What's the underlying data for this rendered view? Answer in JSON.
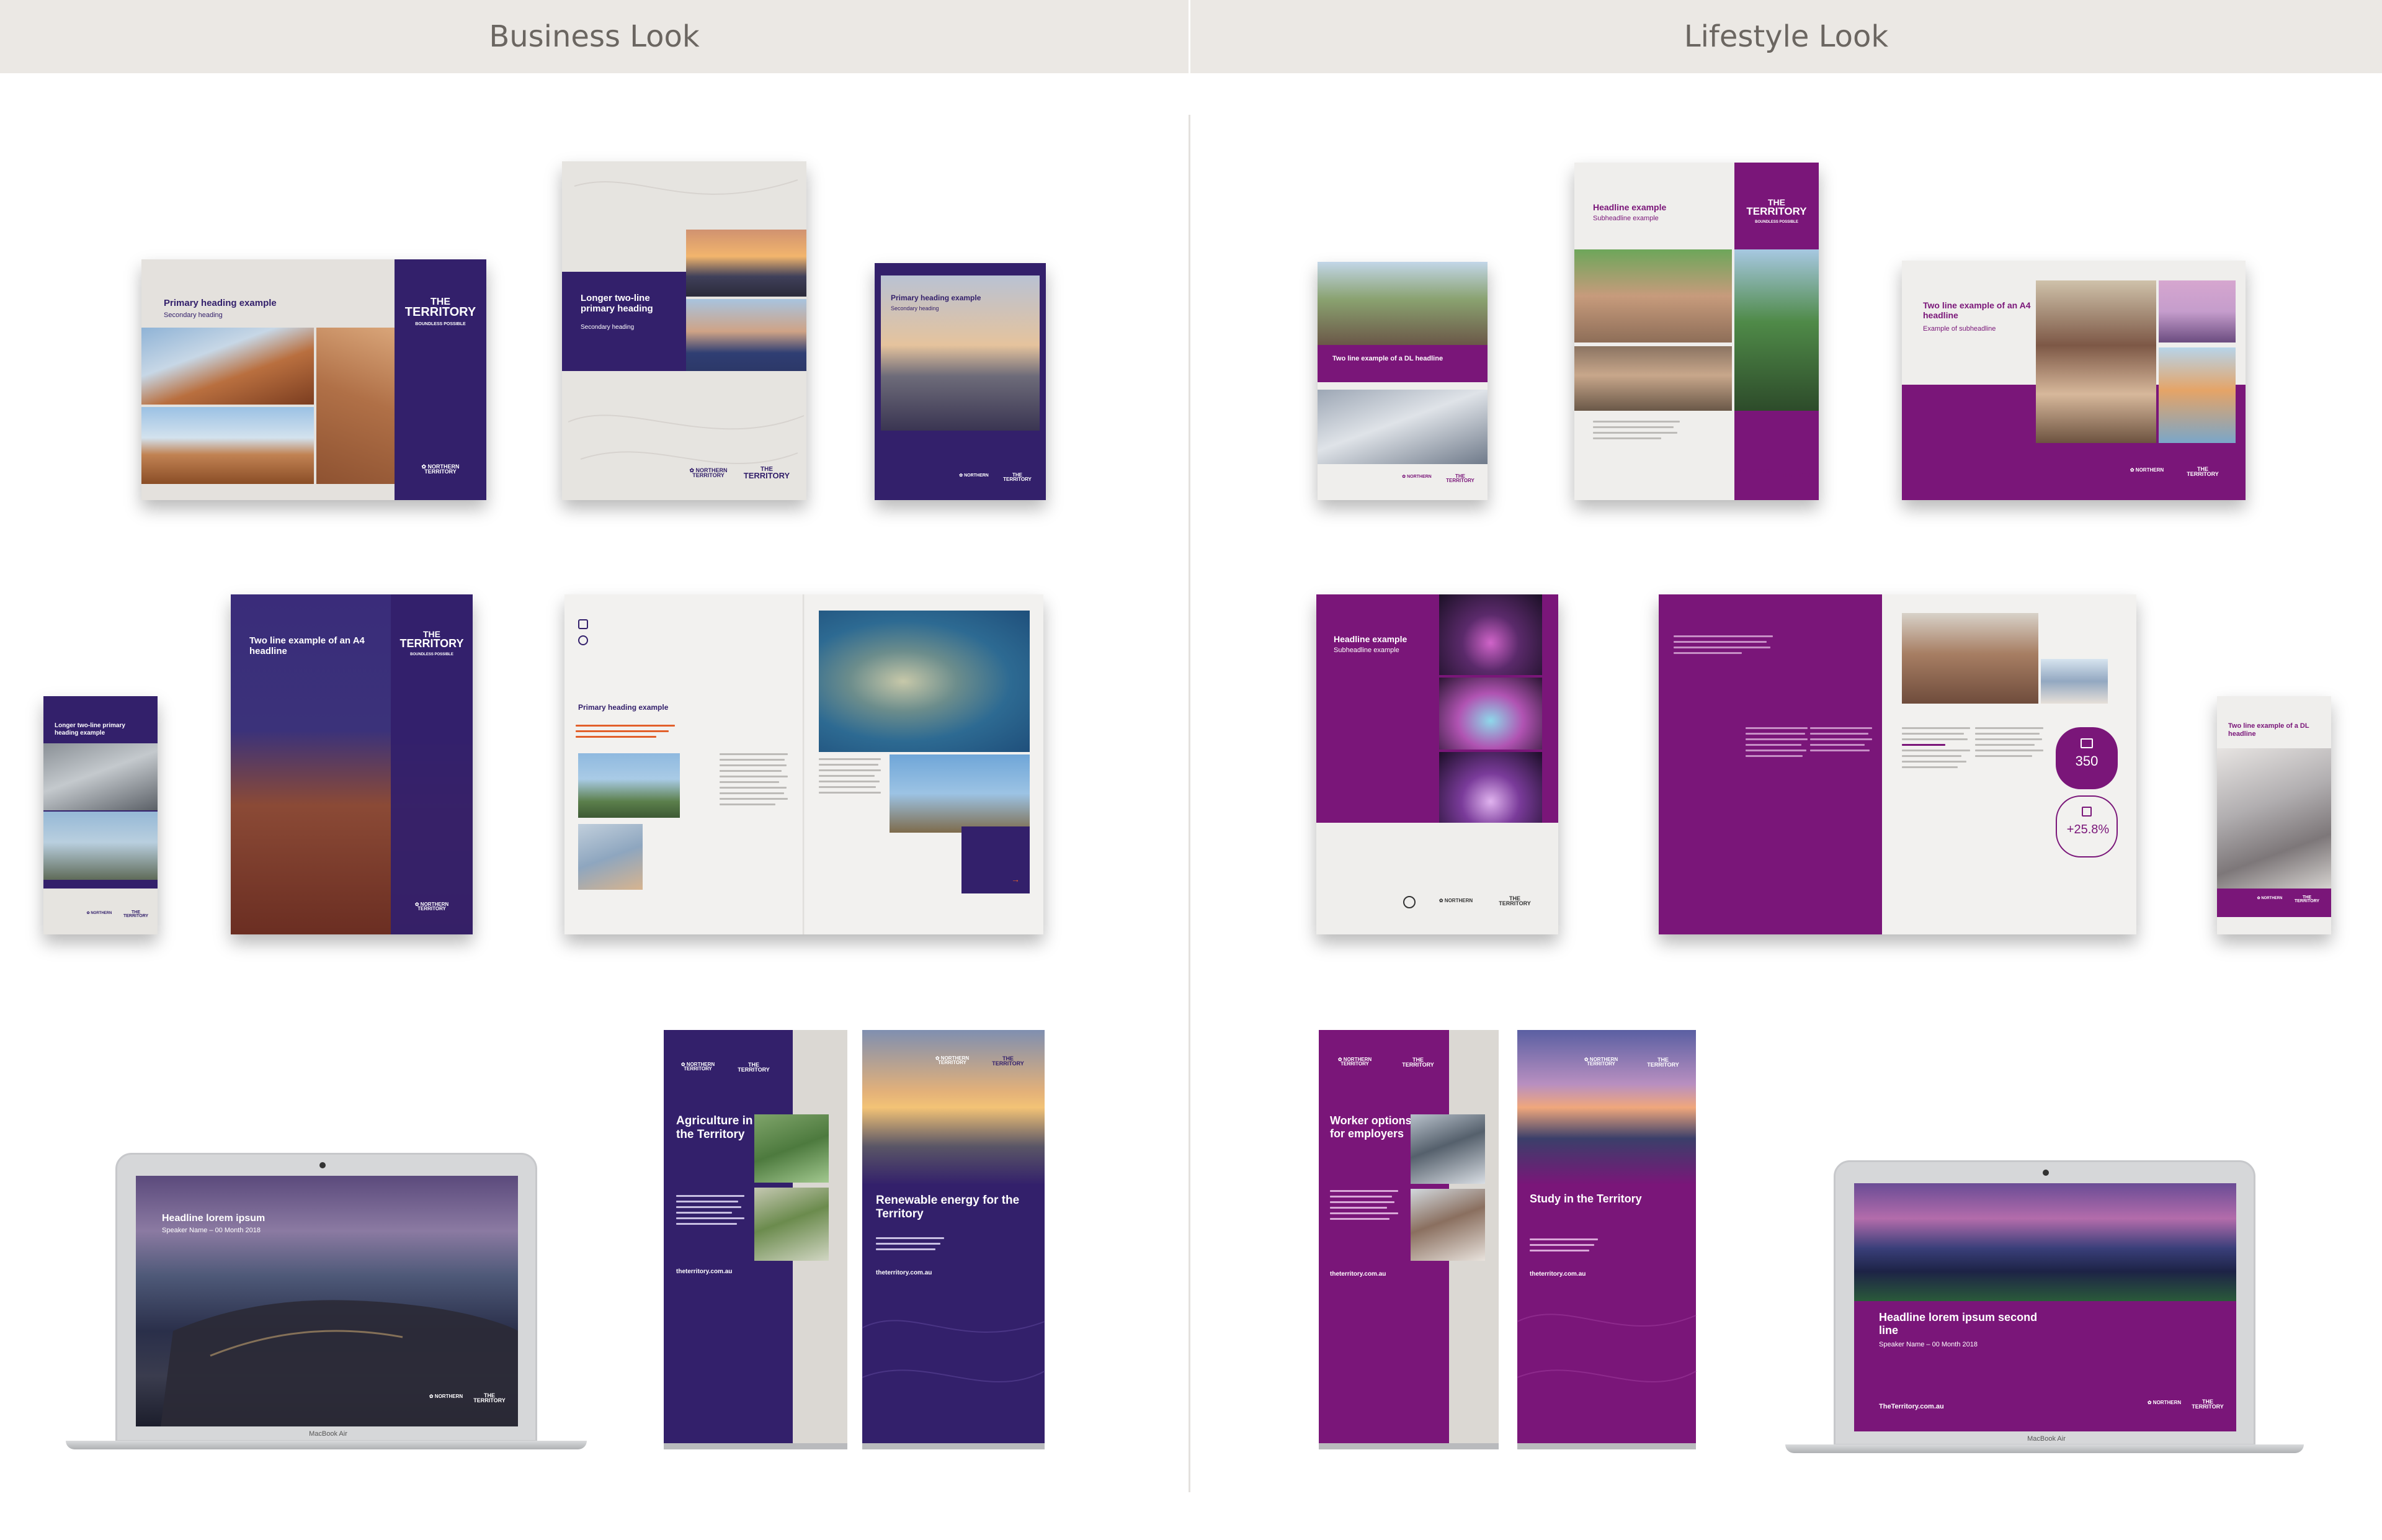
{
  "headers": {
    "business": "Business Look",
    "lifestyle": "Lifestyle Look"
  },
  "colors": {
    "business_purple": "#33206b",
    "lifestyle_purple": "#7a1679",
    "header_bg": "#ebe8e4",
    "header_text": "#6b6661",
    "accent_orange": "#e2602b"
  },
  "brand": {
    "logo_line1": "THE",
    "logo_line2": "TERRITORY",
    "logo_tagline": "BOUNDLESS POSSIBLE",
    "nt_line1": "NORTHERN",
    "nt_line2": "TERRITORY"
  },
  "business": {
    "landscape_report": {
      "title": "Primary heading example",
      "subtitle": "Secondary heading"
    },
    "portrait_report": {
      "title": "Longer two-line primary heading",
      "subtitle": "Secondary heading"
    },
    "small_report": {
      "title": "Primary heading example",
      "subtitle": "Secondary heading"
    },
    "dl_brochure": {
      "title": "Longer two-line primary heading example"
    },
    "a4_cover": {
      "title": "Two line example of an A4 headline"
    },
    "spread": {
      "title": "Primary heading example"
    },
    "laptop": {
      "title": "Headline lorem ipsum",
      "subtitle": "Speaker Name – 00 Month 2018",
      "brand_label": "MacBook Air"
    },
    "banner_agriculture": {
      "title": "Agriculture in the Territory",
      "url": "theterritory.com.au"
    },
    "banner_renewable": {
      "title": "Renewable energy for the Territory",
      "url": "theterritory.com.au"
    }
  },
  "lifestyle": {
    "dl_cover": {
      "title": "Two line example of a DL headline"
    },
    "portrait_cover": {
      "title": "Headline example",
      "subtitle": "Subheadline example"
    },
    "landscape_cover": {
      "title": "Two line example of an A4 headline",
      "subtitle": "Example of subheadline"
    },
    "square_cover": {
      "title": "Headline example",
      "subtitle": "Subheadline example"
    },
    "spread": {
      "stat1": "350",
      "stat2": "+25.8%"
    },
    "dl_brochure": {
      "title": "Two line example of a DL headline"
    },
    "banner_worker": {
      "title": "Worker options for employers",
      "url": "theterritory.com.au"
    },
    "banner_study": {
      "title": "Study in the Territory",
      "url": "theterritory.com.au"
    },
    "laptop": {
      "title": "Headline lorem ipsum second line",
      "subtitle": "Speaker Name – 00 Month 2018",
      "url": "TheTerritory.com.au",
      "brand_label": "MacBook Air"
    }
  }
}
